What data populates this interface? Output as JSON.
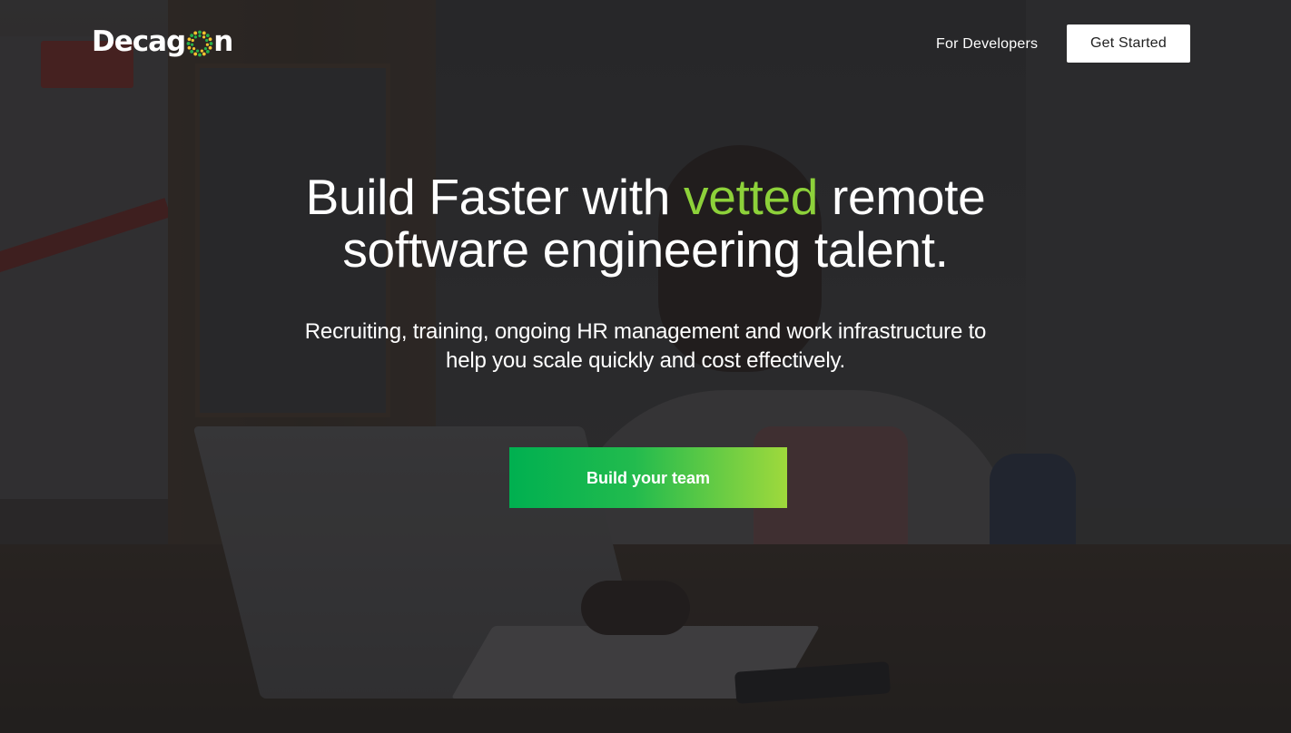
{
  "header": {
    "logo_text_start": "Decag",
    "logo_text_end": "n",
    "nav_link": "For Developers",
    "cta_label": "Get Started"
  },
  "hero": {
    "headline_part1": "Build Faster with ",
    "headline_accent": "vetted",
    "headline_part2": " remote",
    "headline_line2": "software engineering talent.",
    "subhead_line1": "Recruiting, training, ongoing HR management and work infrastructure to",
    "subhead_line2": "help you scale quickly and cost effectively.",
    "cta_label": "Build your team"
  },
  "colors": {
    "accent_green": "#8dd13a",
    "cta_gradient_start": "#00b050",
    "cta_gradient_end": "#9fd93c",
    "logo_ring_yellow": "#f2c230",
    "logo_ring_green": "#27b24a"
  },
  "icons": {
    "logo_ring": "dotted-ring-icon"
  }
}
